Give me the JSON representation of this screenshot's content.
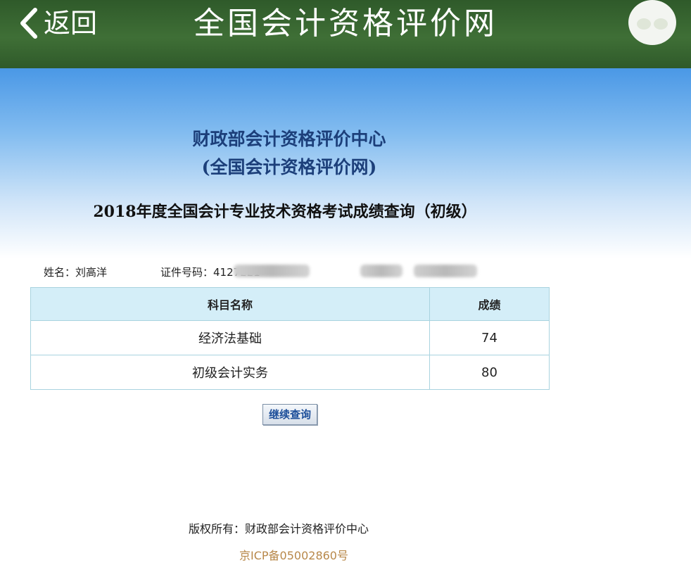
{
  "header": {
    "back_label": "返回",
    "site_title": "全国会计资格评价网"
  },
  "org": {
    "name": "财政部会计资格评价中心",
    "sub": "(全国会计资格评价网)"
  },
  "page_heading": "2018年度全国会计专业技术资格考试成绩查询（初级）",
  "candidate": {
    "name_label": "姓名：",
    "name_value": "刘高洋",
    "id_label": "证件号码：",
    "id_value": "4127221"
  },
  "table": {
    "headers": [
      "科目名称",
      "成绩"
    ],
    "rows": [
      {
        "subject": "经济法基础",
        "score": "74"
      },
      {
        "subject": "初级会计实务",
        "score": "80"
      }
    ]
  },
  "continue_button": "继续查询",
  "footer": {
    "copyright": "版权所有：财政部会计资格评价中心",
    "icp": "京ICP备05002860号"
  },
  "colors": {
    "header_green": "#3f6f36",
    "hero_blue": "#4a98e6",
    "table_header": "#d4eef8",
    "icp_text": "#b8884a"
  }
}
